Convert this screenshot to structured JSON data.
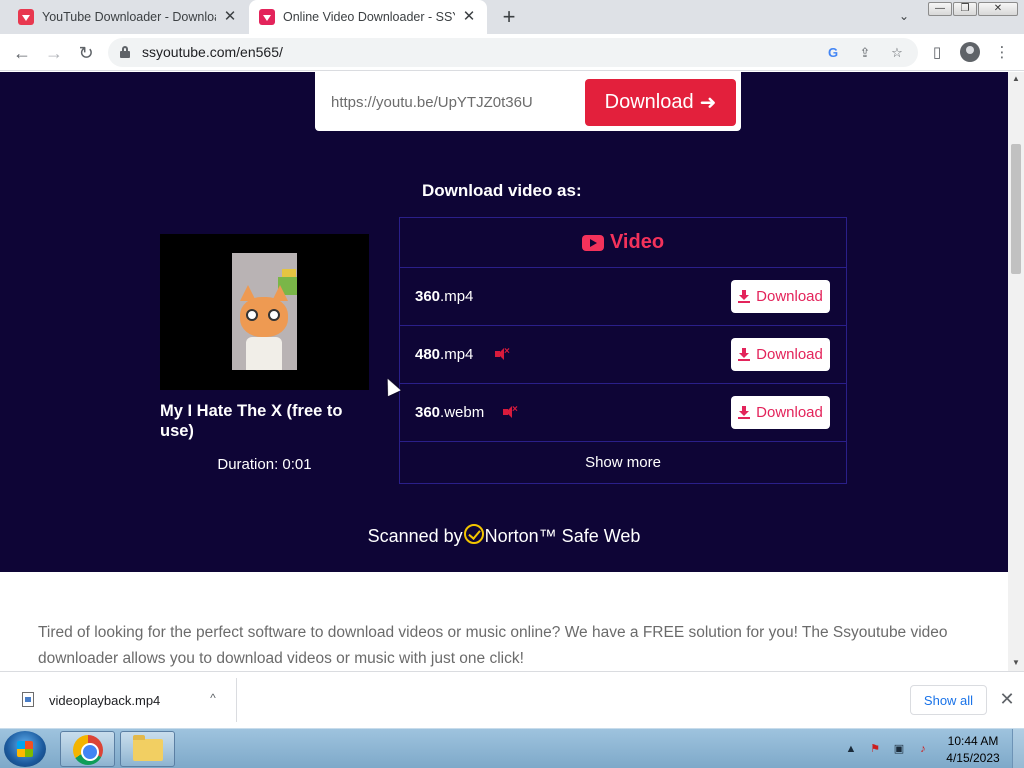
{
  "browser": {
    "tabs": [
      {
        "title": "YouTube Downloader - Download",
        "active": false
      },
      {
        "title": "Online Video Downloader - SSYo",
        "active": true
      }
    ],
    "new_tab_symbol": "+",
    "tab_close_symbol": "✕",
    "url": "ssyoutube.com/en565/",
    "window_controls": [
      "—",
      "❐",
      "✕"
    ]
  },
  "page": {
    "input_value": "https://youtu.be/UpYTJZ0t36U",
    "main_download_label": "Download",
    "main_download_arrow": "➜",
    "download_as_heading": "Download video as:",
    "video": {
      "title": "My I Hate The X (free to use)",
      "duration": "Duration: 0:01"
    },
    "formats_header": "Video",
    "formats": [
      {
        "quality": "360",
        "ext": ".mp4",
        "muted": false,
        "button": "Download"
      },
      {
        "quality": "480",
        "ext": ".mp4",
        "muted": true,
        "button": "Download"
      },
      {
        "quality": "360",
        "ext": ".webm",
        "muted": true,
        "button": "Download"
      }
    ],
    "show_more": "Show more",
    "norton_prefix": "Scanned by",
    "norton_suffix": "Norton™ Safe Web",
    "intro_text": "Tired of looking for the perfect software to download videos or music online? We have a FREE solution for you! The Ssyoutube video downloader allows you to download videos or music with just one click!"
  },
  "download_shelf": {
    "file_name": "videoplayback.mp4",
    "show_all": "Show all",
    "close_symbol": "✕",
    "chevron": "^"
  },
  "taskbar": {
    "time": "10:44 AM",
    "date": "4/15/2023"
  },
  "colors": {
    "hero_bg": "#0e0536",
    "accent_red": "#e3203c",
    "accent_pink": "#f3325b"
  }
}
